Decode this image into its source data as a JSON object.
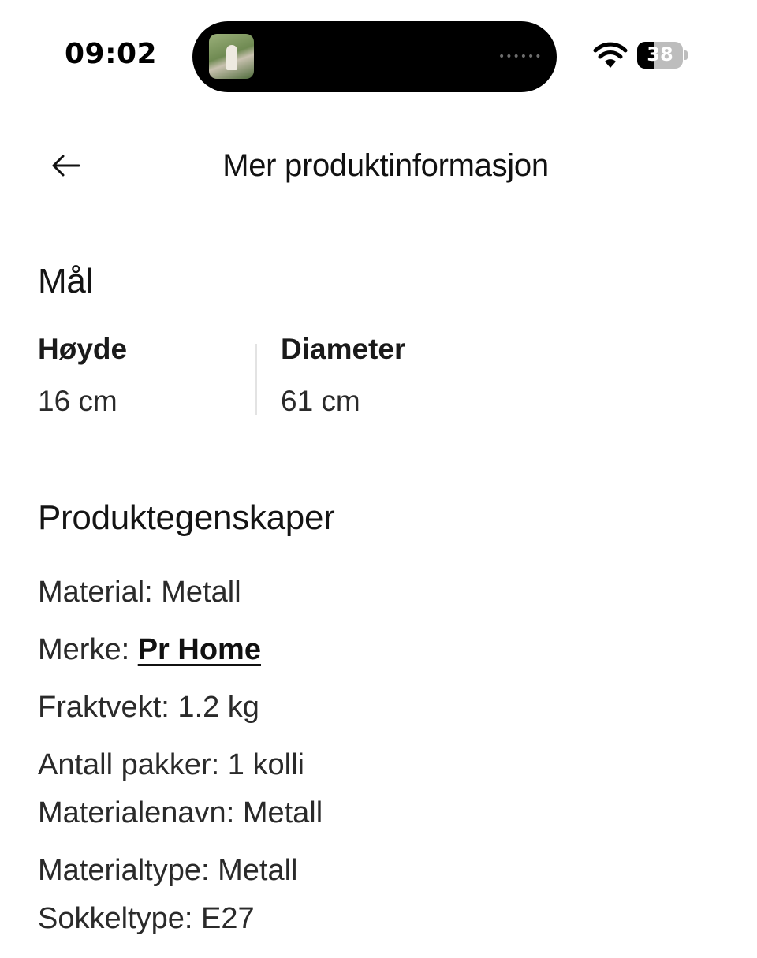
{
  "status_bar": {
    "time": "09:02",
    "battery_level": "38",
    "battery_fraction": 0.38,
    "icons": [
      "wifi-icon",
      "battery-icon"
    ]
  },
  "header": {
    "back_icon": "arrow-left-icon",
    "title": "Mer produktinformasjon"
  },
  "dimensions": {
    "heading": "Mål",
    "items": [
      {
        "label": "Høyde",
        "value": "16 cm"
      },
      {
        "label": "Diameter",
        "value": "61 cm"
      }
    ]
  },
  "properties": {
    "heading": "Produktegenskaper",
    "items": [
      {
        "label": "Material:",
        "value": "Metall"
      },
      {
        "label": "Merke:",
        "value": "Pr Home",
        "link": true
      },
      {
        "label": "Fraktvekt:",
        "value": "1.2 kg"
      },
      {
        "label": "Antall pakker:",
        "value": "1 kolli"
      },
      {
        "label": "Materialenavn:",
        "value": "Metall"
      },
      {
        "label": "Materialtype:",
        "value": "Metall"
      },
      {
        "label": "Sokkeltype:",
        "value": "E27"
      }
    ]
  }
}
